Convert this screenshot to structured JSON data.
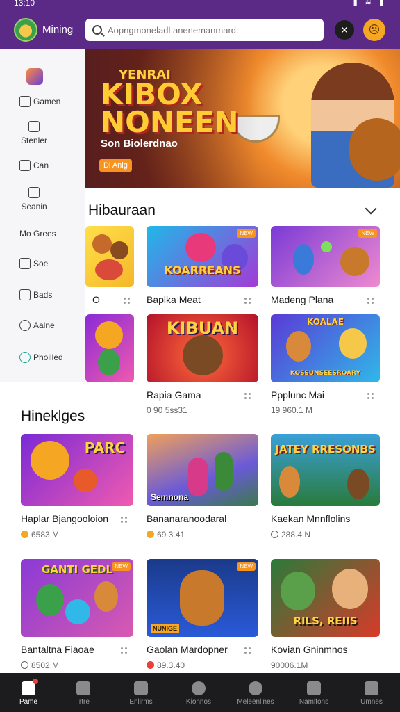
{
  "status": {
    "time": "13:10",
    "icons": "▮ ≋ ▮"
  },
  "header": {
    "app_title": "Mining",
    "search_placeholder": "Aopngmoneladl anenemanmard."
  },
  "sidebar": {
    "items": [
      {
        "label": "Gamen"
      },
      {
        "label": "Stenler"
      },
      {
        "label": "Can"
      },
      {
        "label": "Seanin"
      },
      {
        "label": "Mo Grees"
      },
      {
        "label": "Soe"
      },
      {
        "label": "Bads"
      },
      {
        "label": "Aalne"
      },
      {
        "label": "Phoilled"
      }
    ]
  },
  "hero": {
    "top_text": "YENRAI",
    "big_text_1": "KIBOX",
    "big_text_2": "NONEEN",
    "subtitle": "Son Biolerdnao",
    "cta": "Di Anig"
  },
  "section1": {
    "title": "Hibauraan",
    "cards": [
      {
        "title": "O",
        "meta": ""
      },
      {
        "title": "Baplka Meat",
        "meta": "",
        "art": "KOARREANS"
      },
      {
        "title": "Madeng Plana",
        "meta": ""
      },
      {
        "title": "",
        "meta": ""
      },
      {
        "title": "Rapia Gama",
        "meta": "0 90 5ss31",
        "art": "KIBUAN"
      },
      {
        "title": "Ppplunc Mai",
        "meta": "19 960.1 M",
        "art": "KOALAE",
        "art2": "KOSSUNSEESROARY"
      }
    ]
  },
  "section2": {
    "title": "Hineklges",
    "cards": [
      {
        "title": "Haplar Bjangooloion",
        "meta": "6583.M",
        "art": "PARC"
      },
      {
        "title": "Bananaranoodaral",
        "meta": "69 3.41",
        "art": "Semnona"
      },
      {
        "title": "Kaekan Mnnflolins",
        "meta": "288.4.N",
        "art": "JATEY RRESONBS"
      },
      {
        "title": "Bantaltna Fiaoae",
        "meta": "8502.M",
        "art": "GANTI GEDL"
      },
      {
        "title": "Gaolan Mardopner",
        "meta": "89.3.40",
        "art": "NUNIGE"
      },
      {
        "title": "Kovian Gninmnos",
        "meta": "90006.1M",
        "art": "RILS, REIIS"
      }
    ]
  },
  "bottom_nav": {
    "items": [
      {
        "label": "Pame"
      },
      {
        "label": "Irtre"
      },
      {
        "label": "Enlirms"
      },
      {
        "label": "Kionnos"
      },
      {
        "label": "Meleenlines"
      },
      {
        "label": "Namlfons"
      },
      {
        "label": "Umnes"
      }
    ]
  },
  "colors": {
    "header_bg": "#5b2a86",
    "accent_orange": "#f7931e",
    "nav_bg": "#1c1c1e"
  }
}
